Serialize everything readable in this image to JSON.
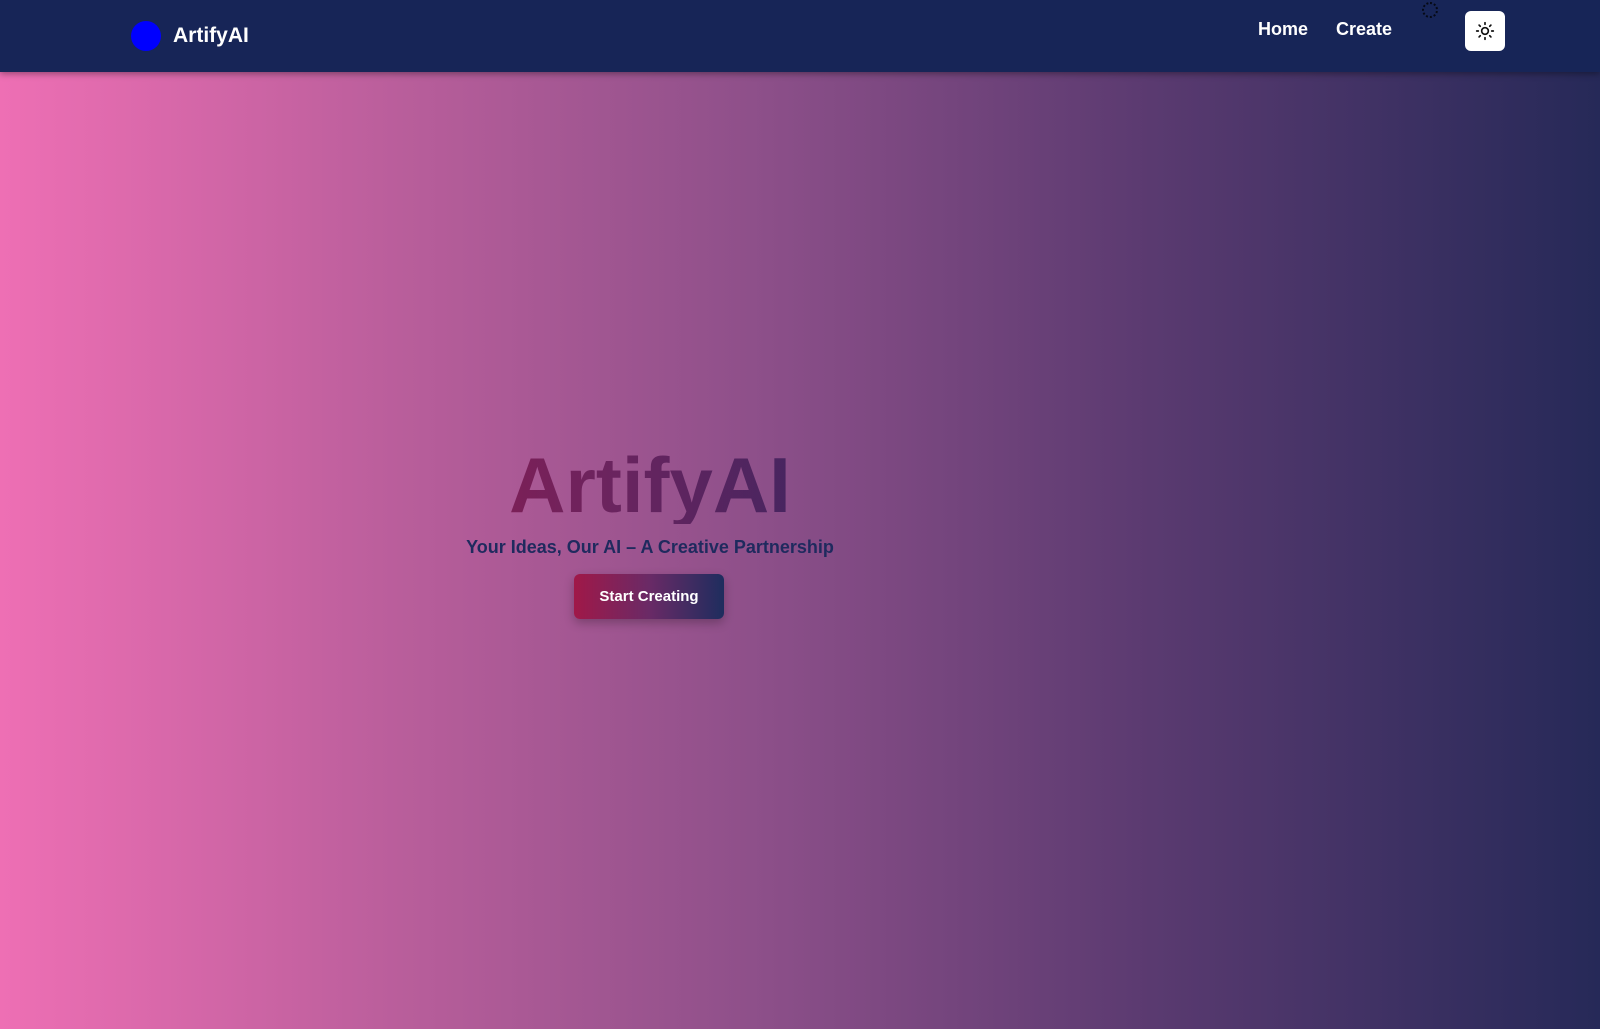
{
  "navbar": {
    "brand_name": "ArtifyAI",
    "links": [
      {
        "label": "Home"
      },
      {
        "label": "Create"
      }
    ],
    "theme_toggle_icon": "sun-icon",
    "loading_icon": "spinner-icon"
  },
  "hero": {
    "title": "ArtifyAI",
    "subtitle": "Your Ideas, Our AI – A Creative Partnership",
    "cta_label": "Start Creating"
  },
  "colors": {
    "navbar_bg": "#172557",
    "brand_dot": "#0000ff",
    "gradient_start": "#ee6fb4",
    "gradient_end": "#262958",
    "subtitle": "#1f2a5e"
  }
}
